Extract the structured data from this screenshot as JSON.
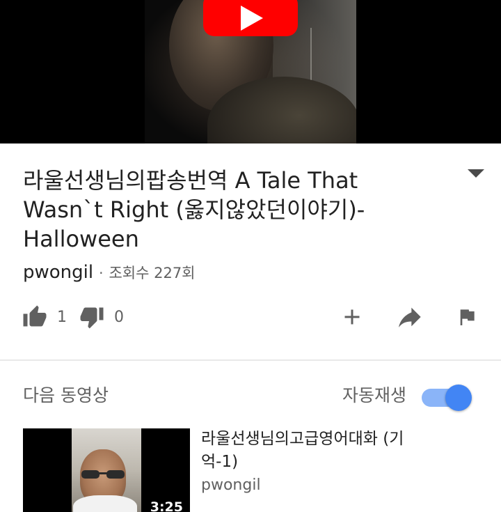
{
  "player": {
    "play_icon": "youtube-play-icon",
    "accent_color": "#ff0000"
  },
  "video": {
    "title": "라울선생님의팝송번역 A Tale That Wasn`t Right (옳지않았던이야기)-Halloween",
    "channel": "pwongil",
    "separator": "·",
    "views": "조회수 227회",
    "expand_icon": "caret-down-icon"
  },
  "actions": {
    "like_count": "1",
    "dislike_count": "0",
    "like_icon": "thumbs-up-icon",
    "dislike_icon": "thumbs-down-icon",
    "add_icon": "plus-icon",
    "share_icon": "share-arrow-icon",
    "report_icon": "flag-icon"
  },
  "up_next": {
    "label": "다음 동영상",
    "autoplay_label": "자동재생",
    "autoplay_on": true,
    "toggle_color": "#4285f4"
  },
  "next_video": {
    "title": "라울선생님의고급영어대화 (기억-1)",
    "channel": "pwongil",
    "duration": "3:25"
  }
}
